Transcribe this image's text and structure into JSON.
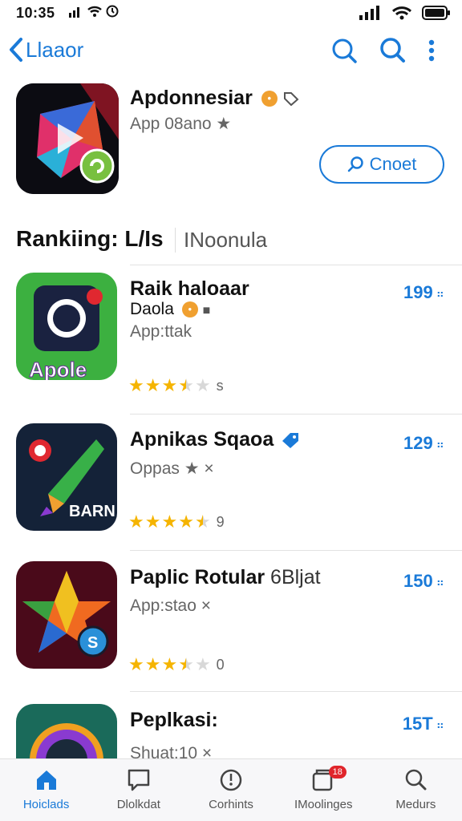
{
  "status": {
    "time": "10:35"
  },
  "header": {
    "back_label": "Llaaor"
  },
  "featured": {
    "title": "Apdonnesiar",
    "subtitle": "App 08ano ★",
    "button_label": "Cnoet"
  },
  "section": {
    "title": "Rankiing: L/Is",
    "tab": "INoonula"
  },
  "apps": [
    {
      "title": "Raik haloaar",
      "developer": "Daola",
      "subtitle": "App:ttak",
      "rank": "199",
      "rating": 3.5,
      "rating_count": "s",
      "icon_text": "Apole"
    },
    {
      "title": "Apnikas Sqaoa",
      "developer": "",
      "subtitle": "Oppas ★ ×",
      "rank": "129",
      "rating": 4.5,
      "rating_count": "9",
      "icon_text": "BARN"
    },
    {
      "title": "Paplic Rotular",
      "developer": "6Bljat",
      "subtitle": "App:stao ×",
      "rank": "150",
      "rating": 3.5,
      "rating_count": "0",
      "icon_text": "S"
    },
    {
      "title": "Peplkasi:",
      "developer": "",
      "subtitle": "Shuat:10 ×",
      "rank": "15T",
      "rating": 0,
      "rating_count": "",
      "icon_text": ""
    }
  ],
  "bottom_nav": [
    {
      "label": "Hoiclads",
      "icon": "home-icon",
      "active": true
    },
    {
      "label": "Dlolkdat",
      "icon": "chat-icon",
      "active": false
    },
    {
      "label": "Corhints",
      "icon": "compass-icon",
      "active": false
    },
    {
      "label": "IMoolinges",
      "icon": "folder-icon",
      "active": false,
      "badge": "18"
    },
    {
      "label": "Medurs",
      "icon": "search-icon",
      "active": false
    }
  ],
  "colors": {
    "accent": "#1a7ad8",
    "star": "#f5b400",
    "badge": "#e0252b"
  }
}
